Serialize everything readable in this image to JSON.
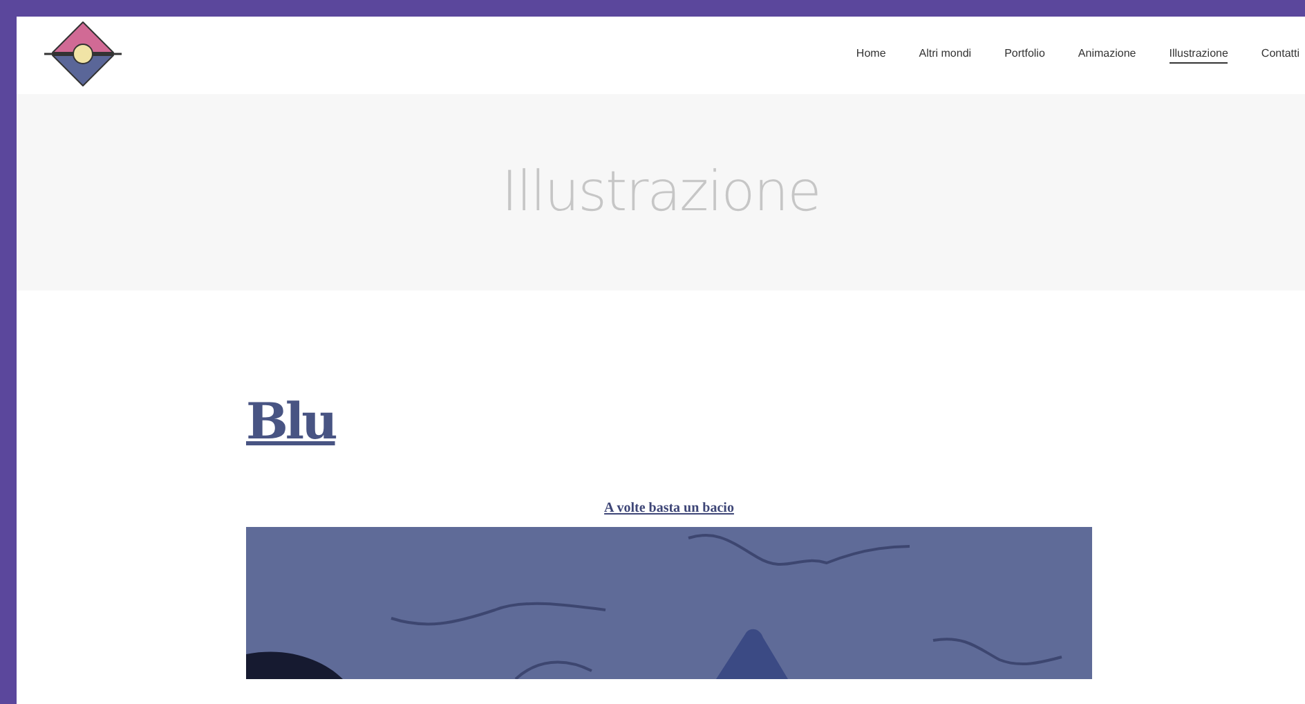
{
  "nav": [
    {
      "label": "Home",
      "selected": false
    },
    {
      "label": "Altri mondi",
      "selected": false
    },
    {
      "label": "Portfolio",
      "selected": false
    },
    {
      "label": "Animazione",
      "selected": false
    },
    {
      "label": "Illustrazione",
      "selected": true
    },
    {
      "label": "Contatti",
      "selected": false
    }
  ],
  "banner": {
    "title": "Illustrazione"
  },
  "post": {
    "title": "Blu",
    "caption": "A volte basta un bacio"
  }
}
